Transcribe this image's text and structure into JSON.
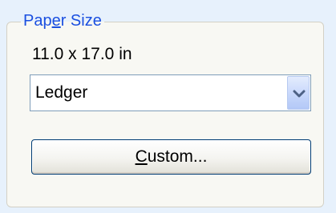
{
  "paper_size": {
    "legend_prefix": "Pap",
    "legend_mnemonic": "e",
    "legend_suffix": "r Size",
    "dimensions_text": "11.0 x 17.0 in",
    "combo": {
      "selected": "Ledger",
      "arrow_icon": "chevron-down-icon"
    },
    "custom_button": {
      "mnemonic": "C",
      "label_rest": "ustom..."
    }
  },
  "colors": {
    "background": "#e7f1fc",
    "group_fill": "#f8f8f3",
    "legend_text": "#1a4fe0",
    "combo_border": "#7f9db9",
    "button_border": "#003c74",
    "arrow_glyph": "#4d6185"
  }
}
